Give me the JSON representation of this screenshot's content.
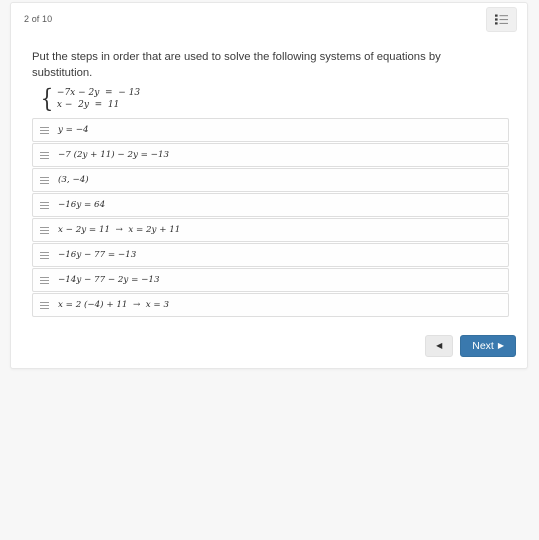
{
  "header": {
    "progress_label": "2 of 10",
    "list_toggle_icon": "bulleted-list-icon"
  },
  "question": {
    "prompt": "Put the steps in order that are used to solve the following systems of equations by substitution.",
    "system": {
      "brace": "{",
      "equation_1": "−7x − 2y  =  − 13",
      "equation_2": "x −  2y  =  11"
    }
  },
  "sortable_list": {
    "handle_icon": "drag-handle-icon",
    "items": [
      {
        "text": "y = −4"
      },
      {
        "text": "−7 (2y + 11) − 2y = −13"
      },
      {
        "text": "(3, −4)"
      },
      {
        "text": "−16y = 64"
      },
      {
        "text": "x − 2y = 11  →  x = 2y + 11"
      },
      {
        "text": "−16y − 77 = −13"
      },
      {
        "text": "−14y − 77 − 2y = −13"
      },
      {
        "text": "x = 2 (−4) + 11  →  x = 3"
      }
    ]
  },
  "footer": {
    "prev_label": "◀",
    "next_label": "Next",
    "next_caret": "▶"
  },
  "colors": {
    "primary_button": "#3a79ae",
    "page_background": "#f7f7f7",
    "card_background": "#ffffff",
    "item_border": "#dedede"
  }
}
